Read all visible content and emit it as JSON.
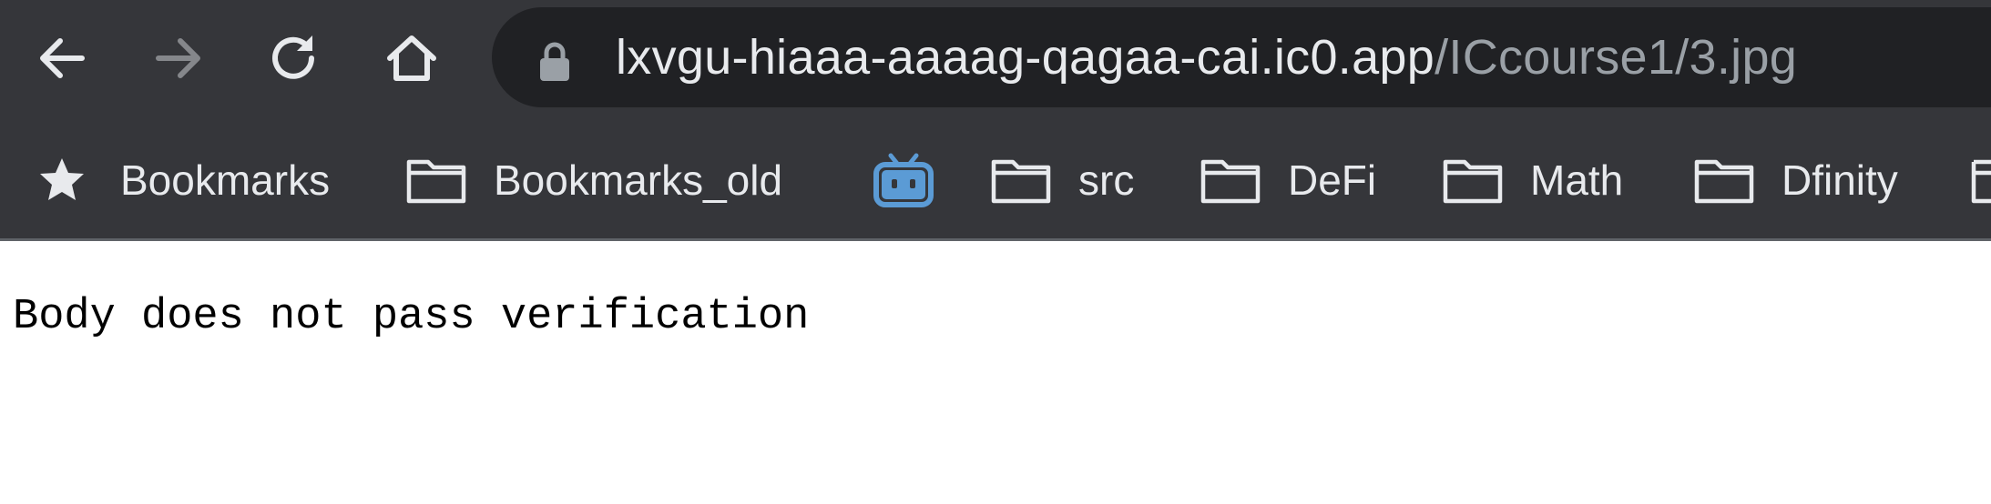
{
  "toolbar": {
    "back_icon": "arrow-left-icon",
    "forward_icon": "arrow-right-icon",
    "reload_icon": "reload-icon",
    "home_icon": "home-icon"
  },
  "address_bar": {
    "lock_icon": "lock-icon",
    "host": "lxvgu-hiaaa-aaaag-qagaa-cai.ic0.app",
    "path": "/ICcourse1/3.jpg"
  },
  "bookmarks_bar": {
    "items": [
      {
        "label": "Bookmarks",
        "icon": "star-icon"
      },
      {
        "label": "Bookmarks_old",
        "icon": "folder-icon"
      },
      {
        "label": "",
        "icon": "bilibili-icon"
      },
      {
        "label": "src",
        "icon": "folder-icon"
      },
      {
        "label": "DeFi",
        "icon": "folder-icon"
      },
      {
        "label": "Math",
        "icon": "folder-icon"
      },
      {
        "label": "Dfinity",
        "icon": "folder-icon"
      }
    ]
  },
  "page": {
    "body_text": "Body does not pass verification"
  },
  "colors": {
    "toolbar_bg": "#35363a",
    "omnibox_bg": "#202124",
    "text_light": "#e8eaed",
    "text_dim": "#9aa0a6",
    "bilibili_blue": "#5b9bd5"
  }
}
